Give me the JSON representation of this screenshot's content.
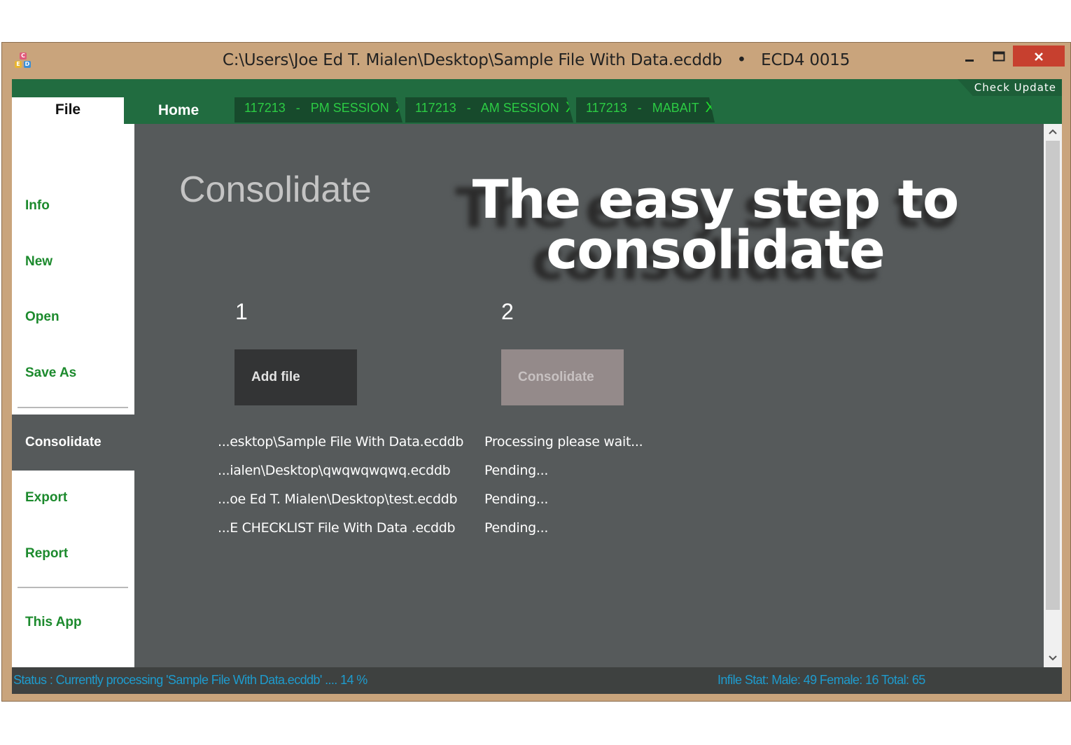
{
  "window": {
    "title": "C:\\Users\\Joe Ed T. Mialen\\Desktop\\Sample File With Data.ecddb",
    "separator": "•",
    "version": "ECD4 0015",
    "icons": [
      "app-logo-icon",
      "minimize-icon",
      "maximize-icon",
      "close-icon"
    ],
    "app_logo_letters": [
      "C",
      "E",
      "D"
    ]
  },
  "toolbar": {
    "check_update": "Check Update",
    "file_tab": "File",
    "home_tab": "Home",
    "session_tabs": [
      {
        "code": "117213",
        "dash": "-",
        "name": "PM SESSION",
        "close": "X"
      },
      {
        "code": "117213",
        "dash": "-",
        "name": "AM SESSION",
        "close": "X"
      },
      {
        "code": "117213",
        "dash": "-",
        "name": "MABAIT",
        "close": "X"
      }
    ]
  },
  "sidebar": {
    "items": [
      "Info",
      "New",
      "Open",
      "Save As",
      "Consolidate",
      "Export",
      "Report",
      "This App"
    ],
    "active": "Consolidate"
  },
  "main": {
    "title": "Consolidate",
    "hero_line1": "The  easy  step  to",
    "hero_line2": "consolidate",
    "step1": "1",
    "step2": "2",
    "add_file_button": "Add file",
    "consolidate_button": "Consolidate",
    "files": [
      "...esktop\\Sample File With Data.ecddb",
      "...ialen\\Desktop\\qwqwqwqwq.ecddb",
      "...oe Ed T. Mialen\\Desktop\\test.ecddb",
      "...E CHECKLIST  File With Data .ecddb"
    ],
    "statuses": [
      "Processing please wait...",
      "Pending...",
      "Pending...",
      "Pending..."
    ]
  },
  "scrollbar": {
    "up": "▲",
    "down": "▼",
    "icons": [
      "chevron-up-icon",
      "chevron-down-icon"
    ]
  },
  "statusbar": {
    "status": "Status : Currently processing 'Sample File With Data.ecddb' .... 14 %",
    "progress_percent": 14,
    "infile_stat": "Infile Stat:  Male: 49  Female: 16   Total: 65"
  },
  "colors": {
    "frame": "#c9a47c",
    "green_bar": "#216c40",
    "tab_text": "#2ccb44",
    "main_bg": "#565a5b",
    "sidebar_text": "#1c8a2d",
    "status_text": "#1e9bcd",
    "close_button": "#c7402f"
  }
}
